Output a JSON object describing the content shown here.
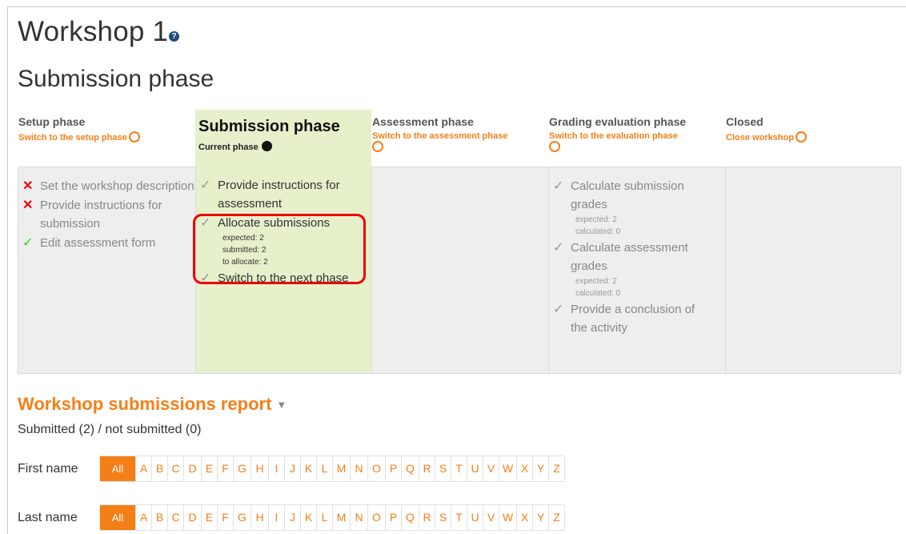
{
  "page": {
    "title": "Workshop 1",
    "help_icon": "question-icon",
    "subtitle": "Submission phase"
  },
  "phases": [
    {
      "title": "Setup phase",
      "action": "Switch to the setup phase",
      "tasks": [
        {
          "icon": "cross-icon",
          "status": "fail",
          "label": "Set the workshop description"
        },
        {
          "icon": "cross-icon",
          "status": "fail",
          "label": "Provide instructions for submission"
        },
        {
          "icon": "check-icon",
          "status": "done",
          "label": "Edit assessment form"
        }
      ]
    },
    {
      "title": "Submission phase",
      "current_label": "Current phase",
      "tasks": [
        {
          "icon": "todo-check-icon",
          "status": "todo",
          "label": "Provide instructions for assessment"
        },
        {
          "icon": "todo-check-icon",
          "status": "todo",
          "label": "Allocate submissions",
          "details": [
            "expected: 2",
            "submitted: 2",
            "to allocate: 2"
          ]
        },
        {
          "icon": "todo-check-icon",
          "status": "todo",
          "label": "Switch to the next phase"
        }
      ]
    },
    {
      "title": "Assessment phase",
      "action": "Switch to the assessment phase",
      "tasks": []
    },
    {
      "title": "Grading evaluation phase",
      "action": "Switch to the evaluation phase",
      "tasks": [
        {
          "icon": "todo-check-icon",
          "status": "todo",
          "label": "Calculate submission grades",
          "details": [
            "expected: 2",
            "calculated: 0"
          ]
        },
        {
          "icon": "todo-check-icon",
          "status": "todo",
          "label": "Calculate assessment grades",
          "details": [
            "expected: 2",
            "calculated: 0"
          ]
        },
        {
          "icon": "todo-check-icon",
          "status": "todo",
          "label": "Provide a conclusion of the activity"
        }
      ]
    },
    {
      "title": "Closed",
      "action": "Close workshop",
      "tasks": []
    }
  ],
  "report": {
    "title": "Workshop submissions report",
    "summary": "Submitted (2) / not submitted (0)"
  },
  "initials": {
    "first_label": "First name",
    "last_label": "Last name",
    "all_label": "All",
    "letters": [
      "A",
      "B",
      "C",
      "D",
      "E",
      "F",
      "G",
      "H",
      "I",
      "J",
      "K",
      "L",
      "M",
      "N",
      "O",
      "P",
      "Q",
      "R",
      "S",
      "T",
      "U",
      "V",
      "W",
      "X",
      "Y",
      "Z"
    ]
  },
  "colors": {
    "accent": "#f57f17",
    "active_bg": "#e6f0cb",
    "inactive_bg": "#eeeeee",
    "highlight": "#e00000"
  }
}
